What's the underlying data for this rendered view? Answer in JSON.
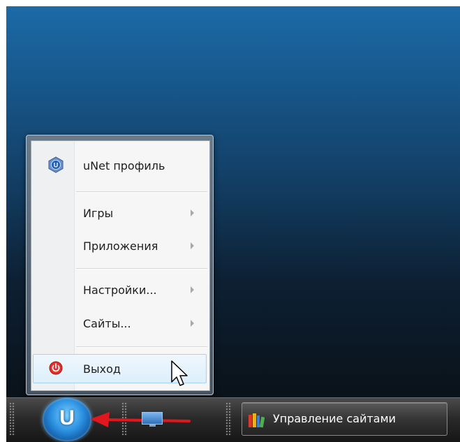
{
  "start_menu": {
    "items": [
      {
        "label": "uNet профиль",
        "icon": "unet-profile-icon",
        "submenu": false
      },
      {
        "label": "Игры",
        "icon": "",
        "submenu": true
      },
      {
        "label": "Приложения",
        "icon": "",
        "submenu": true
      },
      {
        "label": "Настройки...",
        "icon": "",
        "submenu": true
      },
      {
        "label": "Сайты...",
        "icon": "",
        "submenu": true
      },
      {
        "label": "Выход",
        "icon": "power-icon",
        "submenu": false
      }
    ],
    "hovered_item": "Выход"
  },
  "taskbar": {
    "start_button_letter": "U",
    "task_button_label": "Управление сайтами",
    "task_button_icon": "books-icon",
    "show_desktop_icon": "desktop-icon"
  },
  "colors": {
    "desktop_top": "#1c6aa7",
    "desktop_bottom": "#0a1219",
    "accent": "#2a8fe0",
    "pointer_arrow": "#e0181e"
  }
}
